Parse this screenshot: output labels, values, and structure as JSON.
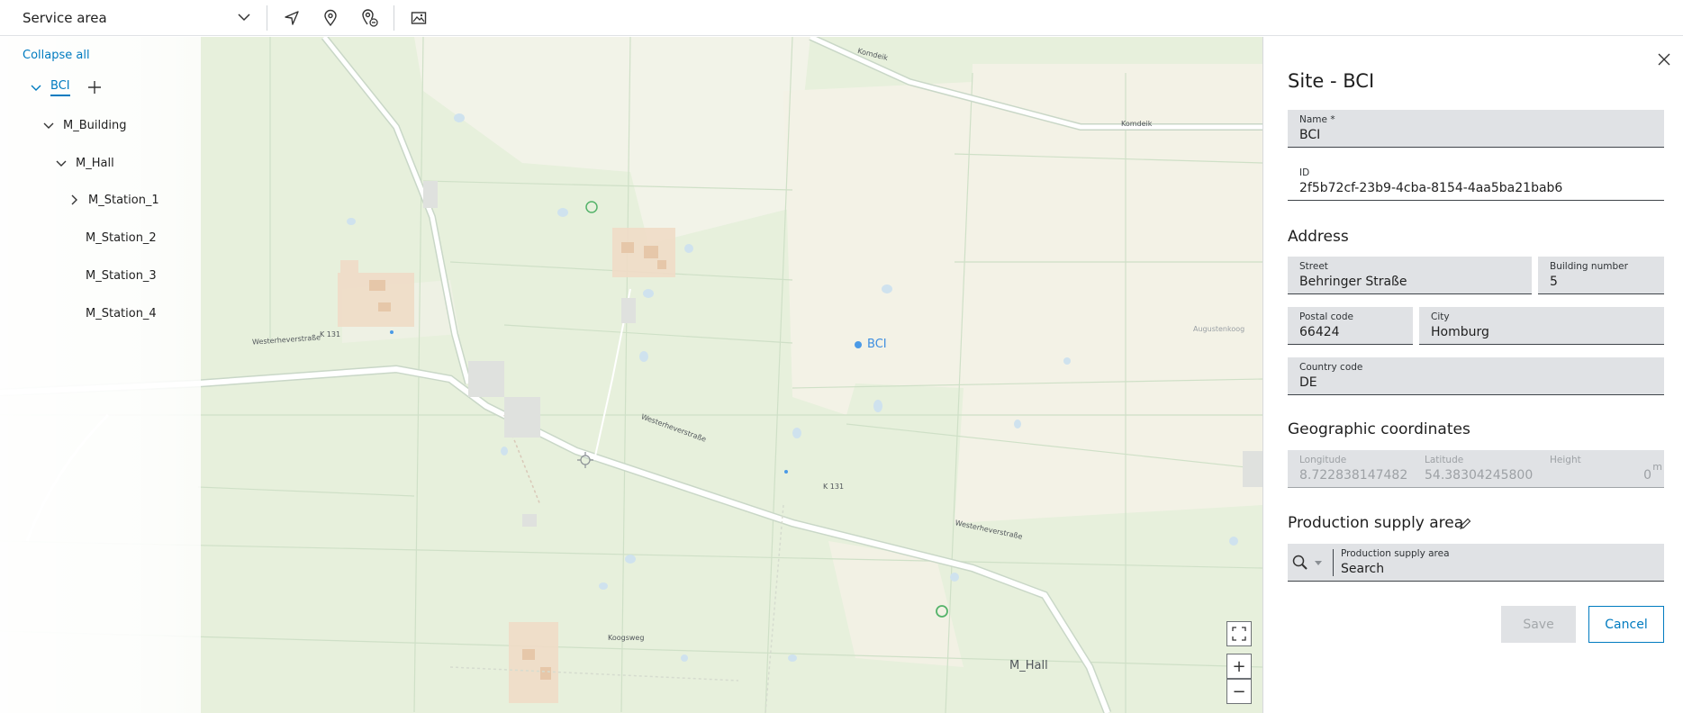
{
  "toolbar": {
    "service_select_value": "Service area",
    "icons": [
      "chevron-down-icon",
      "navigation-arrow-icon",
      "location-pin-icon",
      "location-pin-remove-icon",
      "map-image-icon"
    ]
  },
  "tree": {
    "collapse_all": "Collapse all",
    "root": "BCI",
    "building": "M_Building",
    "hall": "M_Hall",
    "stations": [
      "M_Station_1",
      "M_Station_2",
      "M_Station_3",
      "M_Station_4"
    ]
  },
  "map": {
    "labels": {
      "bci": "BCI",
      "m_hall": "M_Hall",
      "road_k131_a": "K 131",
      "road_k131_b": "K 131",
      "street_wester_a": "Westerheverstraße",
      "street_wester_b": "Westerheverstraße",
      "street_wester_c": "Westerheverstraße",
      "augusten": "Augustenkoog",
      "koog": "Koogsweg",
      "komdeik_a": "Komdeik",
      "komdeik_b": "Komdeik"
    },
    "controls": {
      "zoom_in": "+",
      "zoom_out": "−"
    }
  },
  "panel": {
    "title": "Site - BCI",
    "name_label": "Name *",
    "name_value": "BCI",
    "id_label": "ID",
    "id_value": "2f5b72cf-23b9-4cba-8154-4aa5ba21bab6",
    "address_heading": "Address",
    "street_label": "Street",
    "street_value": "Behringer Straße",
    "building_label": "Building number",
    "building_value": "5",
    "postal_label": "Postal code",
    "postal_value": "66424",
    "city_label": "City",
    "city_value": "Homburg",
    "country_label": "Country code",
    "country_value": "DE",
    "geo_heading": "Geographic coordinates",
    "longitude_label": "Longitude",
    "longitude_value": "8.722838147482",
    "latitude_label": "Latitude",
    "latitude_value": "54.38304245800",
    "height_label": "Height",
    "height_value": "0",
    "height_unit": "m",
    "psa_heading": "Production supply area",
    "psa_field_label": "Production supply area",
    "psa_field_value": "Search",
    "save_label": "Save",
    "cancel_label": "Cancel"
  },
  "colors": {
    "accent": "#007bc0",
    "map_green": "#e7f0de",
    "field_bg": "#e0e2e5"
  }
}
